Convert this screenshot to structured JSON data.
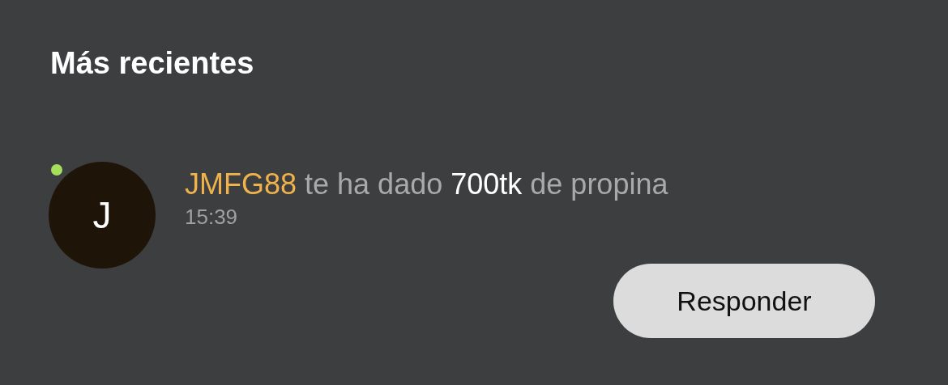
{
  "section_title": "Más recientes",
  "notification": {
    "avatar_letter": "J",
    "online": true,
    "sender": "JMFG88",
    "action": "te ha dado",
    "amount": "700tk",
    "rest": "de propina",
    "time": "15:39"
  },
  "buttons": [
    "Responder"
  ]
}
